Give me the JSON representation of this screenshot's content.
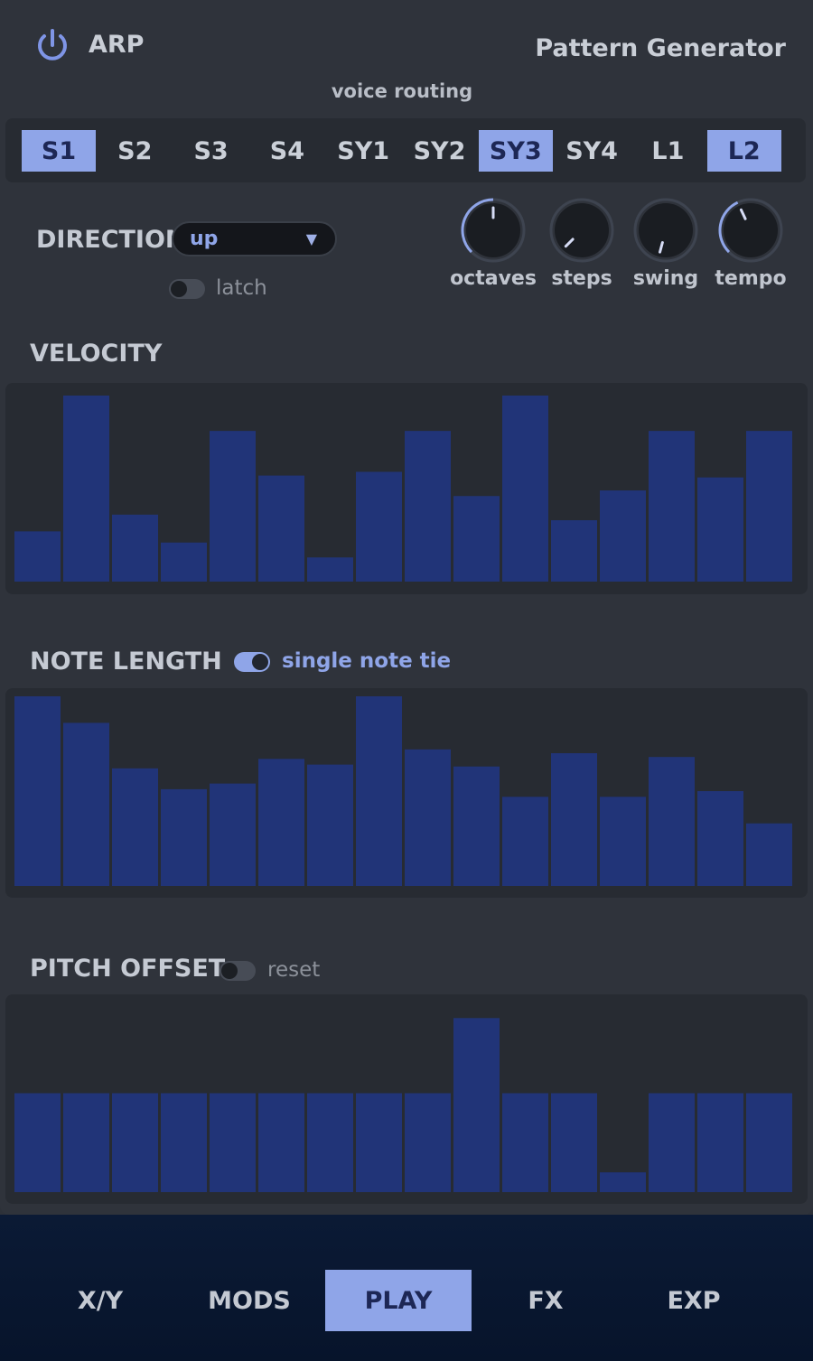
{
  "header": {
    "arp_label": "ARP",
    "title": "Pattern Generator",
    "power_icon": "power-icon"
  },
  "routing": {
    "caption": "voice routing",
    "voices": [
      {
        "label": "S1",
        "active": true
      },
      {
        "label": "S2",
        "active": false
      },
      {
        "label": "S3",
        "active": false
      },
      {
        "label": "S4",
        "active": false
      },
      {
        "label": "SY1",
        "active": false
      },
      {
        "label": "SY2",
        "active": false
      },
      {
        "label": "SY3",
        "active": true
      },
      {
        "label": "SY4",
        "active": false
      },
      {
        "label": "L1",
        "active": false
      },
      {
        "label": "L2",
        "active": true
      }
    ]
  },
  "direction": {
    "label": "DIRECTION",
    "value": "up",
    "latch_label": "latch",
    "latch_on": false
  },
  "knobs": [
    {
      "label": "octaves",
      "angle": 0
    },
    {
      "label": "steps",
      "angle": -135
    },
    {
      "label": "swing",
      "angle": -165
    },
    {
      "label": "tempo",
      "angle": -25
    }
  ],
  "velocity": {
    "title": "VELOCITY",
    "values": [
      0.27,
      1.0,
      0.36,
      0.21,
      0.81,
      0.57,
      0.13,
      0.59,
      0.81,
      0.46,
      1.0,
      0.33,
      0.49,
      0.81,
      0.56,
      0.81
    ]
  },
  "note_length": {
    "title": "NOTE LENGTH",
    "tie_label": "single note tie",
    "tie_on": true,
    "values": [
      1.0,
      0.86,
      0.62,
      0.51,
      0.54,
      0.67,
      0.64,
      1.0,
      0.72,
      0.63,
      0.47,
      0.7,
      0.47,
      0.68,
      0.5,
      0.33
    ]
  },
  "pitch_offset": {
    "title": "PITCH OFFSET",
    "reset_label": "reset",
    "reset_on": false,
    "values": [
      0.5,
      0.5,
      0.5,
      0.5,
      0.5,
      0.5,
      0.5,
      0.5,
      0.5,
      0.88,
      0.5,
      0.5,
      0.1,
      0.5,
      0.5,
      0.5
    ]
  },
  "nav": {
    "tabs": [
      {
        "label": "X/Y",
        "active": false
      },
      {
        "label": "MODS",
        "active": false
      },
      {
        "label": "PLAY",
        "active": true
      },
      {
        "label": "FX",
        "active": false
      },
      {
        "label": "EXP",
        "active": false
      }
    ]
  },
  "colors": {
    "accent": "#8fa5e8",
    "bar": "#213478",
    "panel": "#2f333b",
    "bar_bg": "#272b32"
  }
}
